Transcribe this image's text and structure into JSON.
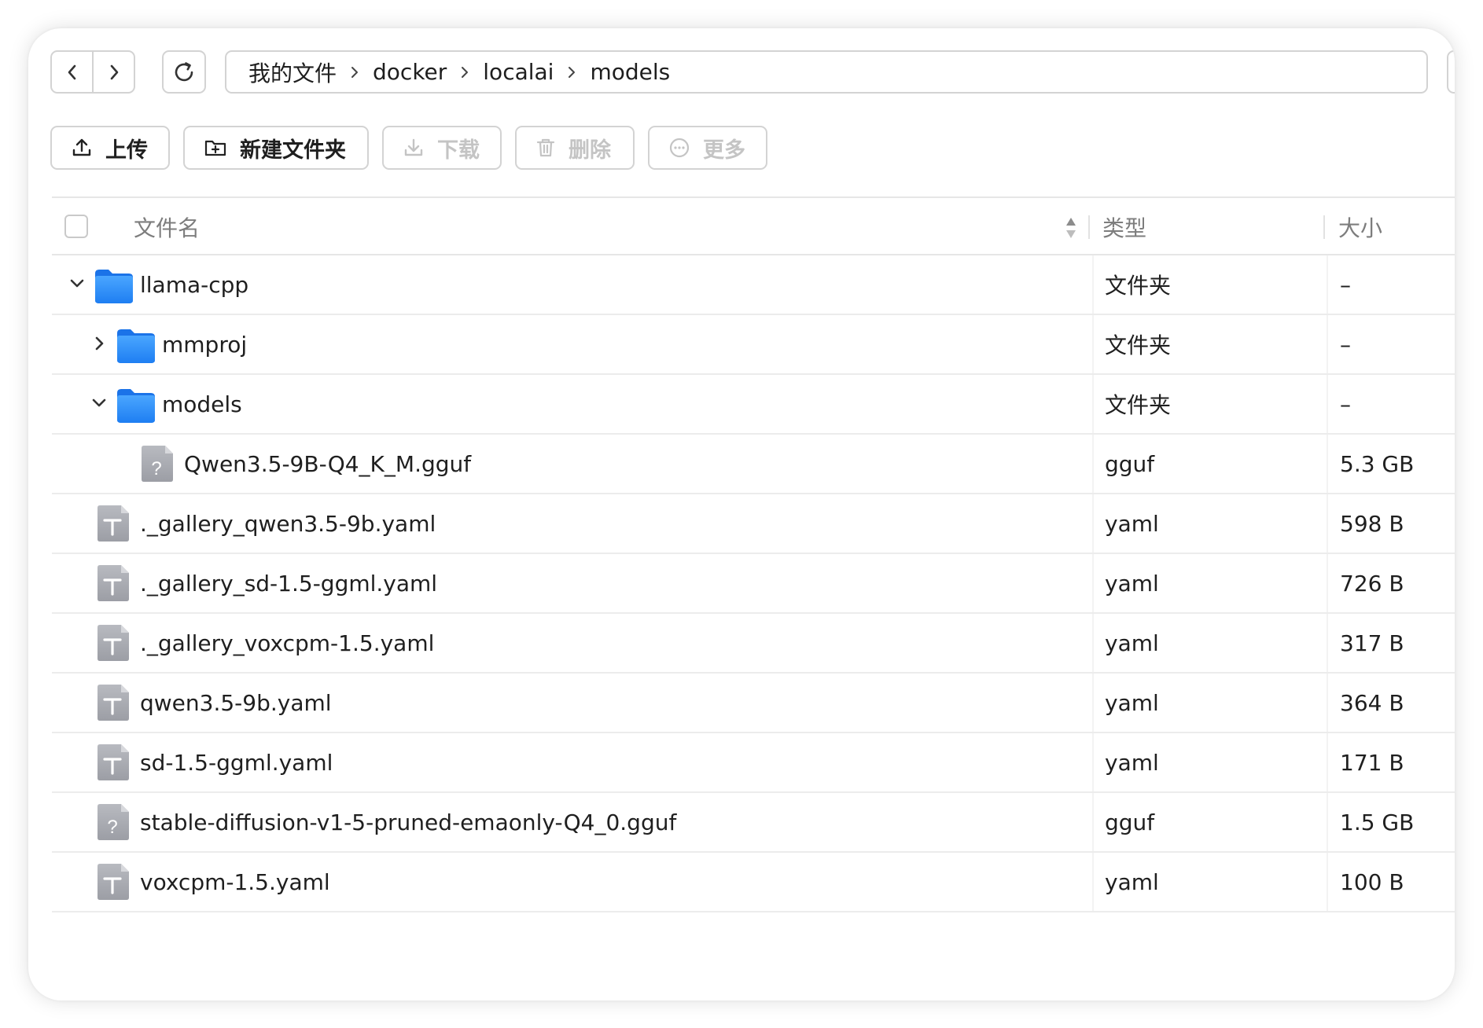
{
  "breadcrumb": [
    "我的文件",
    "docker",
    "localai",
    "models"
  ],
  "actions": {
    "upload": "上传",
    "new_folder": "新建文件夹",
    "download": "下载",
    "delete": "删除",
    "more": "更多"
  },
  "table": {
    "columns": {
      "name": "文件名",
      "type": "类型",
      "size": "大小"
    },
    "rows": [
      {
        "name": "llama-cpp",
        "type": "文件夹",
        "size": "–",
        "icon": "folder-icon",
        "expander": "chevron-down-icon"
      },
      {
        "name": "mmproj",
        "type": "文件夹",
        "size": "–",
        "icon": "folder-icon",
        "expander": "chevron-right-icon"
      },
      {
        "name": "models",
        "type": "文件夹",
        "size": "–",
        "icon": "folder-icon",
        "expander": "chevron-down-icon"
      },
      {
        "name": "Qwen3.5-9B-Q4_K_M.gguf",
        "type": "gguf",
        "size": "5.3 GB",
        "icon": "unknown-file-icon"
      },
      {
        "name": "._gallery_qwen3.5-9b.yaml",
        "type": "yaml",
        "size": "598 B",
        "icon": "text-file-icon"
      },
      {
        "name": "._gallery_sd-1.5-ggml.yaml",
        "type": "yaml",
        "size": "726 B",
        "icon": "text-file-icon"
      },
      {
        "name": "._gallery_voxcpm-1.5.yaml",
        "type": "yaml",
        "size": "317 B",
        "icon": "text-file-icon"
      },
      {
        "name": "qwen3.5-9b.yaml",
        "type": "yaml",
        "size": "364 B",
        "icon": "text-file-icon"
      },
      {
        "name": "sd-1.5-ggml.yaml",
        "type": "yaml",
        "size": "171 B",
        "icon": "text-file-icon"
      },
      {
        "name": "stable-diffusion-v1-5-pruned-emaonly-Q4_0.gguf",
        "type": "gguf",
        "size": "1.5 GB",
        "icon": "unknown-file-icon"
      },
      {
        "name": "voxcpm-1.5.yaml",
        "type": "yaml",
        "size": "100 B",
        "icon": "text-file-icon"
      }
    ]
  },
  "colors": {
    "folder_blue": "#2f8cf6",
    "file_gray": "#a9abb1",
    "border": "#d3d3d3",
    "disabled_text": "#c4c4c4"
  }
}
